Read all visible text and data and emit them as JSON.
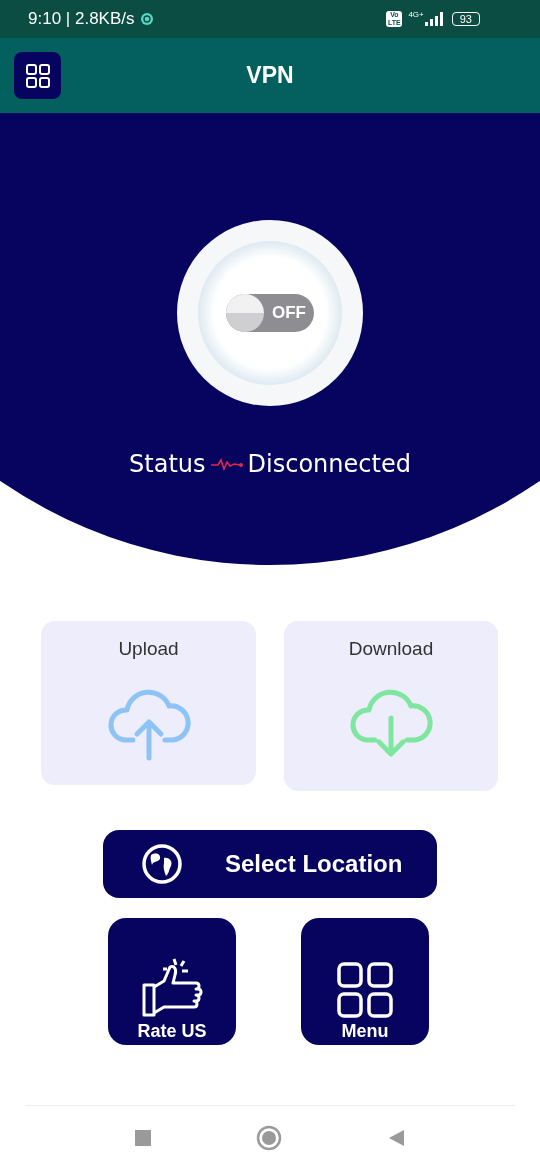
{
  "status_bar": {
    "time": "9:10 | 2.8KB/s",
    "volte": "Vo LTE",
    "network": "4G+",
    "battery": "93"
  },
  "app_bar": {
    "title": "VPN"
  },
  "power": {
    "label": "OFF",
    "on": false
  },
  "status": {
    "label": "Status",
    "value": "Disconnected"
  },
  "speed_cards": [
    {
      "kind": "upload",
      "label": "Upload"
    },
    {
      "kind": "download",
      "label": "Download"
    }
  ],
  "location_button": {
    "label": "Select Location"
  },
  "tiles": [
    {
      "kind": "rate",
      "label": "Rate US"
    },
    {
      "kind": "menu",
      "label": "Menu"
    }
  ]
}
